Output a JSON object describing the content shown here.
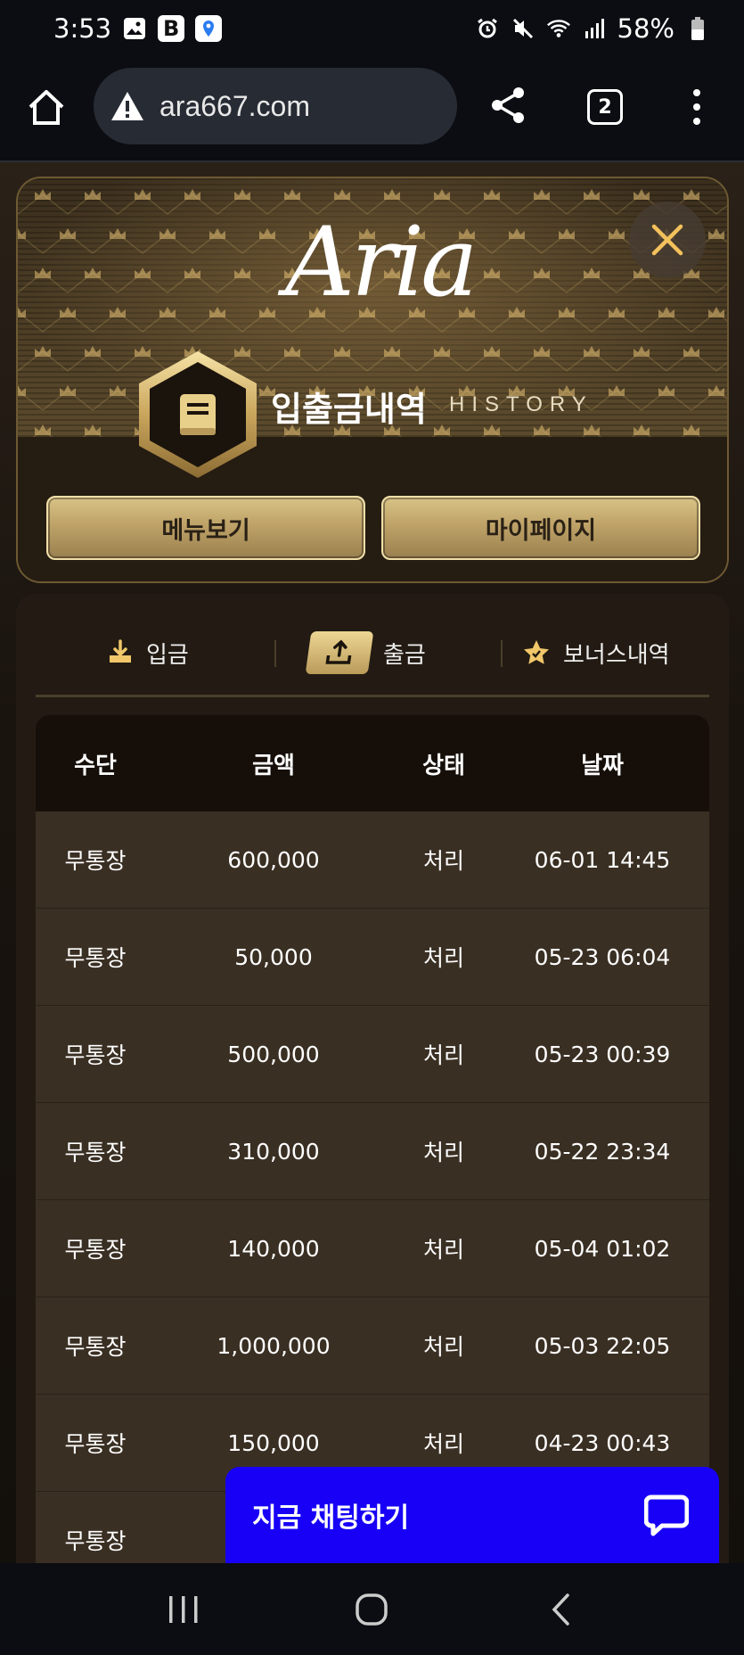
{
  "status_bar": {
    "time": "3:53",
    "battery": "58%",
    "app_icon_letter": "B"
  },
  "browser": {
    "url": "ara667.com",
    "tab_count": "2"
  },
  "header": {
    "logo": "Aria",
    "title": "입출금내역",
    "subtitle": "HISTORY",
    "menu_button": "메뉴보기",
    "mypage_button": "마이페이지"
  },
  "tabs": {
    "deposit": "입금",
    "withdraw": "출금",
    "bonus": "보너스내역",
    "active": "withdraw"
  },
  "table": {
    "headers": [
      "수단",
      "금액",
      "상태",
      "날짜"
    ],
    "rows": [
      {
        "method": "무통장",
        "amount": "600,000",
        "status": "처리",
        "date": "06-01 14:45"
      },
      {
        "method": "무통장",
        "amount": "50,000",
        "status": "처리",
        "date": "05-23 06:04"
      },
      {
        "method": "무통장",
        "amount": "500,000",
        "status": "처리",
        "date": "05-23 00:39"
      },
      {
        "method": "무통장",
        "amount": "310,000",
        "status": "처리",
        "date": "05-22 23:34"
      },
      {
        "method": "무통장",
        "amount": "140,000",
        "status": "처리",
        "date": "05-04 01:02"
      },
      {
        "method": "무통장",
        "amount": "1,000,000",
        "status": "처리",
        "date": "05-03 22:05"
      },
      {
        "method": "무통장",
        "amount": "150,000",
        "status": "처리",
        "date": "04-23 00:43"
      },
      {
        "method": "무통장",
        "amount": "",
        "status": "",
        "date": ""
      }
    ]
  },
  "chat": {
    "label": "지금 채팅하기"
  },
  "colors": {
    "gold": "#c9ad6e",
    "chat_blue": "#1700f5",
    "row_bg": "#3a2f23",
    "header_bg": "#160f09"
  }
}
